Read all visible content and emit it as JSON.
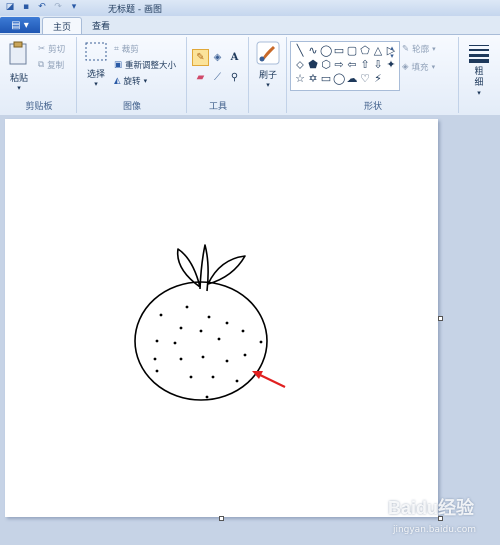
{
  "window": {
    "title": "无标题 - 画图"
  },
  "tabs": [
    {
      "label": "主页",
      "active": true
    },
    {
      "label": "查看",
      "active": false
    }
  ],
  "ribbon": {
    "clipboard": {
      "paste": "粘贴",
      "cut": "剪切",
      "copy": "复制",
      "label": "剪贴板"
    },
    "image": {
      "select": "选择",
      "crop": "裁剪",
      "resize": "重新调整大小",
      "rotate": "旋转",
      "label": "图像"
    },
    "tools": {
      "label": "工具",
      "items": [
        "pencil-icon",
        "fill-icon",
        "text-icon",
        "eraser-icon",
        "color-picker-icon",
        "magnifier-icon"
      ],
      "selected": "pencil-icon"
    },
    "brushes": {
      "label": "刷子"
    },
    "shapes": {
      "label": "形状",
      "outline": "轮廓",
      "fill": "填充",
      "glyphs": [
        "╲",
        "∿",
        "◯",
        "▭",
        "▢",
        "⬠",
        "△",
        "▷",
        "⬦",
        "⬟",
        "⬡",
        "⇨",
        "⇦",
        "⇧",
        "⇩",
        "✦",
        "☆",
        "✡",
        "▭",
        "◯",
        "☁",
        "♡",
        "⚡"
      ]
    },
    "size": {
      "label": "粗细"
    }
  },
  "accent_colors": {
    "file_tab": "#2a63c4",
    "selected_tool": "#fbe39a",
    "arrow": "#e02020"
  },
  "watermark": {
    "text": "Baidu经验",
    "sub": "jingyan.baidu.com"
  }
}
